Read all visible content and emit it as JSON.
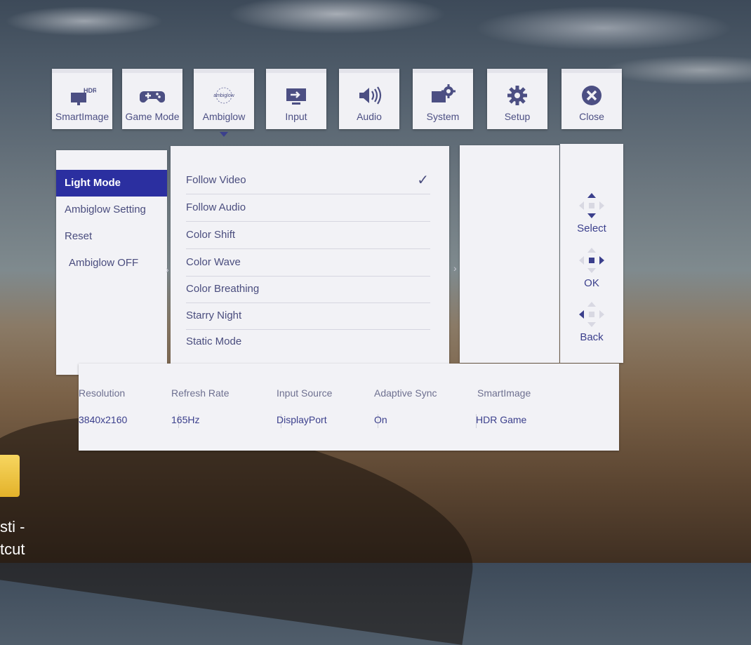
{
  "tabs": [
    {
      "label": "SmartImage",
      "icon": "hdr-display-icon"
    },
    {
      "label": "Game Mode",
      "icon": "gamepad-icon"
    },
    {
      "label": "Ambiglow",
      "icon": "ambiglow-logo-icon",
      "logo_text": "ambiglow"
    },
    {
      "label": "Input",
      "icon": "input-icon"
    },
    {
      "label": "Audio",
      "icon": "speaker-icon"
    },
    {
      "label": "System",
      "icon": "system-gear-icon"
    },
    {
      "label": "Setup",
      "icon": "gear-icon"
    },
    {
      "label": "Close",
      "icon": "close-icon"
    }
  ],
  "active_tab": "Ambiglow",
  "hdr_badge": "HDR",
  "left_menu": [
    "Light Mode",
    "Ambiglow Setting",
    "Reset",
    "Ambiglow OFF"
  ],
  "selected_menu": "Light Mode",
  "options": [
    "Follow Video",
    "Follow Audio",
    "Color Shift",
    "Color Wave",
    "Color Breathing",
    "Starry Night",
    "Static Mode"
  ],
  "checked_option": "Follow Video",
  "nav": {
    "select": "Select",
    "ok": "OK",
    "back": "Back"
  },
  "status": {
    "headers": [
      "Resolution",
      "Refresh Rate",
      "Input Source",
      "Adaptive Sync",
      "SmartImage"
    ],
    "values": [
      "3840x2160",
      "165Hz",
      "DisplayPort",
      "On",
      "HDR Game"
    ]
  },
  "desktop": {
    "line1": "sti -",
    "line2": "tcut"
  },
  "colors": {
    "accent": "#2b2fa0",
    "text": "#4a4d7e",
    "panel": "#f2f2f6"
  }
}
